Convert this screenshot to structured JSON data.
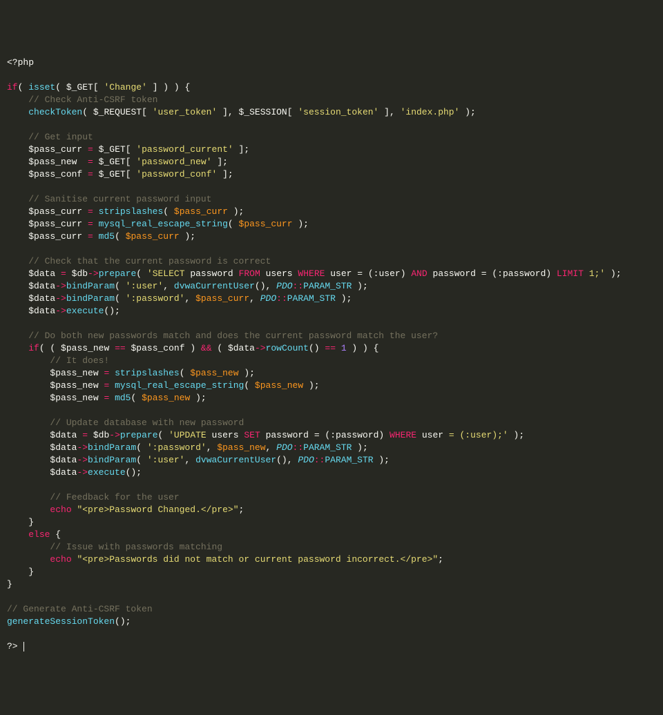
{
  "syntax": {
    "php_open": "<?php",
    "php_close": "?>",
    "kw_if": "if",
    "kw_else": "else",
    "kw_echo": "echo",
    "kw_isset": "isset",
    "fn_checkToken": "checkToken",
    "fn_stripslashes": "stripslashes",
    "fn_mres": "mysql_real_escape_string",
    "fn_md5": "md5",
    "fn_prepare": "prepare",
    "fn_bindParam": "bindParam",
    "fn_execute": "execute",
    "fn_rowCount": "rowCount",
    "fn_dvwaCU": "dvwaCurrentUser",
    "fn_genTok": "generateSessionToken",
    "cls_PDO": "PDO",
    "const_PSTR": "PARAM_STR",
    "v_GET": "$_GET",
    "v_REQ": "$_REQUEST",
    "v_SES": "$_SESSION",
    "v_pcurr": "$pass_curr",
    "v_pnew": "$pass_new",
    "v_pconf": "$pass_conf",
    "v_data": "$data",
    "v_db": "$db",
    "s_Change": "'Change'",
    "s_user_token": "'user_token'",
    "s_session_token": "'session_token'",
    "s_index": "'index.php'",
    "s_pwd_cur": "'password_current'",
    "s_pwd_new": "'password_new'",
    "s_pwd_conf": "'password_conf'",
    "s_user": "':user'",
    "s_password": "':password'",
    "sql_sel_1": "'SELECT",
    "sql_sel_pwd": "password",
    "sql_from": "FROM",
    "sql_users": "users",
    "sql_where": "WHERE",
    "sql_user": "user",
    "sql_eq_user": "= (:user)",
    "sql_and": "AND",
    "sql_eq_pwd": "= (:password)",
    "sql_limit": "LIMIT",
    "sql_one_end": "1;'",
    "sql_update": "'UPDATE",
    "sql_set": "SET",
    "sql_upd_end": "= (:user);'",
    "n_one": "1",
    "echo_changed": "\"<pre>Password Changed.</pre>\"",
    "echo_nomatch": "\"<pre>Passwords did not match or current password incorrect.</pre>\"",
    "cmt_csrf": "// Check Anti-CSRF token",
    "cmt_getin": "// Get input",
    "cmt_san": "// Sanitise current password input",
    "cmt_chk": "// Check that the current password is correct",
    "cmt_both": "// Do both new passwords match and does the current password match the user?",
    "cmt_itdoes": "// It does!",
    "cmt_upd": "// Update database with new password",
    "cmt_fb": "// Feedback for the user",
    "cmt_issue": "// Issue with passwords matching",
    "cmt_gen": "// Generate Anti-CSRF token",
    "op_eq": "=",
    "op_deq": "==",
    "op_and": "&&",
    "op_arrow": "->",
    "op_scope": "::"
  }
}
